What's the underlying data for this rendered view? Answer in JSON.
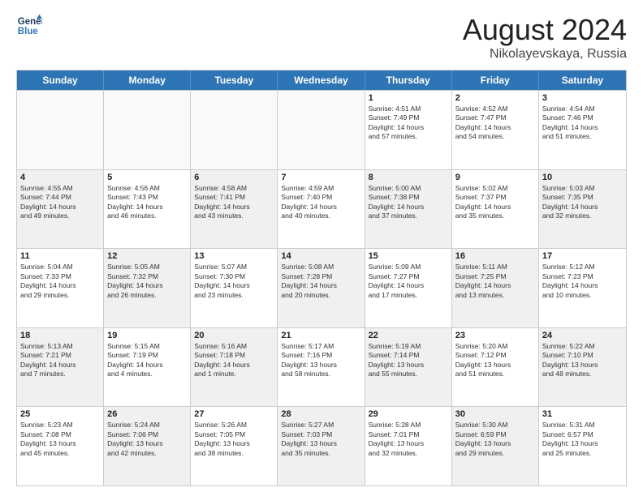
{
  "header": {
    "logo_line1": "General",
    "logo_line2": "Blue",
    "main_title": "August 2024",
    "sub_title": "Nikolayevskaya, Russia"
  },
  "days_of_week": [
    "Sunday",
    "Monday",
    "Tuesday",
    "Wednesday",
    "Thursday",
    "Friday",
    "Saturday"
  ],
  "rows": [
    [
      {
        "day": "",
        "text": "",
        "empty": true
      },
      {
        "day": "",
        "text": "",
        "empty": true
      },
      {
        "day": "",
        "text": "",
        "empty": true
      },
      {
        "day": "",
        "text": "",
        "empty": true
      },
      {
        "day": "1",
        "text": "Sunrise: 4:51 AM\nSunset: 7:49 PM\nDaylight: 14 hours\nand 57 minutes."
      },
      {
        "day": "2",
        "text": "Sunrise: 4:52 AM\nSunset: 7:47 PM\nDaylight: 14 hours\nand 54 minutes."
      },
      {
        "day": "3",
        "text": "Sunrise: 4:54 AM\nSunset: 7:46 PM\nDaylight: 14 hours\nand 51 minutes."
      }
    ],
    [
      {
        "day": "4",
        "text": "Sunrise: 4:55 AM\nSunset: 7:44 PM\nDaylight: 14 hours\nand 49 minutes.",
        "shaded": true
      },
      {
        "day": "5",
        "text": "Sunrise: 4:56 AM\nSunset: 7:43 PM\nDaylight: 14 hours\nand 46 minutes."
      },
      {
        "day": "6",
        "text": "Sunrise: 4:58 AM\nSunset: 7:41 PM\nDaylight: 14 hours\nand 43 minutes.",
        "shaded": true
      },
      {
        "day": "7",
        "text": "Sunrise: 4:59 AM\nSunset: 7:40 PM\nDaylight: 14 hours\nand 40 minutes."
      },
      {
        "day": "8",
        "text": "Sunrise: 5:00 AM\nSunset: 7:38 PM\nDaylight: 14 hours\nand 37 minutes.",
        "shaded": true
      },
      {
        "day": "9",
        "text": "Sunrise: 5:02 AM\nSunset: 7:37 PM\nDaylight: 14 hours\nand 35 minutes."
      },
      {
        "day": "10",
        "text": "Sunrise: 5:03 AM\nSunset: 7:35 PM\nDaylight: 14 hours\nand 32 minutes.",
        "shaded": true
      }
    ],
    [
      {
        "day": "11",
        "text": "Sunrise: 5:04 AM\nSunset: 7:33 PM\nDaylight: 14 hours\nand 29 minutes."
      },
      {
        "day": "12",
        "text": "Sunrise: 5:05 AM\nSunset: 7:32 PM\nDaylight: 14 hours\nand 26 minutes.",
        "shaded": true
      },
      {
        "day": "13",
        "text": "Sunrise: 5:07 AM\nSunset: 7:30 PM\nDaylight: 14 hours\nand 23 minutes."
      },
      {
        "day": "14",
        "text": "Sunrise: 5:08 AM\nSunset: 7:28 PM\nDaylight: 14 hours\nand 20 minutes.",
        "shaded": true
      },
      {
        "day": "15",
        "text": "Sunrise: 5:09 AM\nSunset: 7:27 PM\nDaylight: 14 hours\nand 17 minutes."
      },
      {
        "day": "16",
        "text": "Sunrise: 5:11 AM\nSunset: 7:25 PM\nDaylight: 14 hours\nand 13 minutes.",
        "shaded": true
      },
      {
        "day": "17",
        "text": "Sunrise: 5:12 AM\nSunset: 7:23 PM\nDaylight: 14 hours\nand 10 minutes."
      }
    ],
    [
      {
        "day": "18",
        "text": "Sunrise: 5:13 AM\nSunset: 7:21 PM\nDaylight: 14 hours\nand 7 minutes.",
        "shaded": true
      },
      {
        "day": "19",
        "text": "Sunrise: 5:15 AM\nSunset: 7:19 PM\nDaylight: 14 hours\nand 4 minutes."
      },
      {
        "day": "20",
        "text": "Sunrise: 5:16 AM\nSunset: 7:18 PM\nDaylight: 14 hours\nand 1 minute.",
        "shaded": true
      },
      {
        "day": "21",
        "text": "Sunrise: 5:17 AM\nSunset: 7:16 PM\nDaylight: 13 hours\nand 58 minutes."
      },
      {
        "day": "22",
        "text": "Sunrise: 5:19 AM\nSunset: 7:14 PM\nDaylight: 13 hours\nand 55 minutes.",
        "shaded": true
      },
      {
        "day": "23",
        "text": "Sunrise: 5:20 AM\nSunset: 7:12 PM\nDaylight: 13 hours\nand 51 minutes."
      },
      {
        "day": "24",
        "text": "Sunrise: 5:22 AM\nSunset: 7:10 PM\nDaylight: 13 hours\nand 48 minutes.",
        "shaded": true
      }
    ],
    [
      {
        "day": "25",
        "text": "Sunrise: 5:23 AM\nSunset: 7:08 PM\nDaylight: 13 hours\nand 45 minutes."
      },
      {
        "day": "26",
        "text": "Sunrise: 5:24 AM\nSunset: 7:06 PM\nDaylight: 13 hours\nand 42 minutes.",
        "shaded": true
      },
      {
        "day": "27",
        "text": "Sunrise: 5:26 AM\nSunset: 7:05 PM\nDaylight: 13 hours\nand 38 minutes."
      },
      {
        "day": "28",
        "text": "Sunrise: 5:27 AM\nSunset: 7:03 PM\nDaylight: 13 hours\nand 35 minutes.",
        "shaded": true
      },
      {
        "day": "29",
        "text": "Sunrise: 5:28 AM\nSunset: 7:01 PM\nDaylight: 13 hours\nand 32 minutes."
      },
      {
        "day": "30",
        "text": "Sunrise: 5:30 AM\nSunset: 6:59 PM\nDaylight: 13 hours\nand 29 minutes.",
        "shaded": true
      },
      {
        "day": "31",
        "text": "Sunrise: 5:31 AM\nSunset: 6:57 PM\nDaylight: 13 hours\nand 25 minutes."
      }
    ]
  ]
}
